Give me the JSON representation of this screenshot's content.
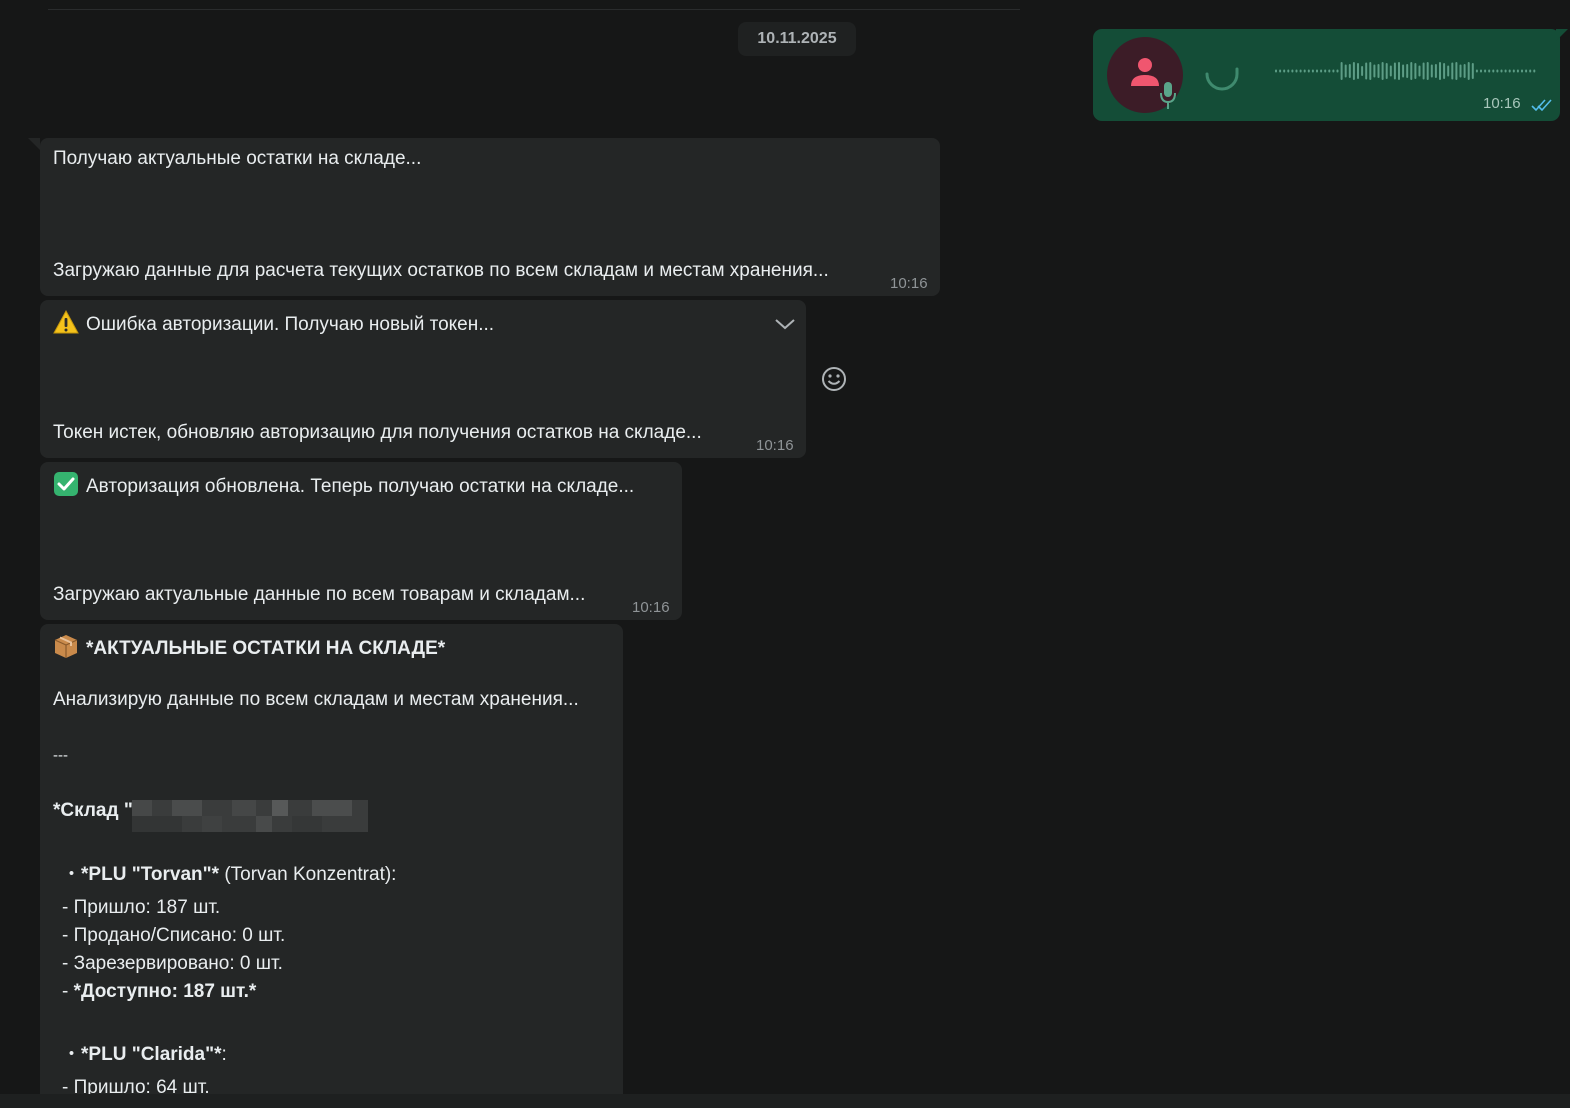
{
  "date_separator": "10.11.2025",
  "voice_message": {
    "time": "10:16",
    "status_icon": "double-check-icon",
    "accent_color": "#53bdeb"
  },
  "messages": [
    {
      "lines": [
        "Получаю актуальные остатки на складе...",
        "Загружаю данные для расчета текущих остатков по всем складам и местам хранения..."
      ],
      "time": "10:16"
    },
    {
      "icon": "warning-icon",
      "lines": [
        "Ошибка авторизации. Получаю новый токен...",
        "Токен истек, обновляю авторизацию для получения остатков на складе..."
      ],
      "time": "10:16"
    },
    {
      "icon": "check-mark-icon",
      "lines": [
        "Авторизация обновлена. Теперь получаю остатки на складе...",
        "Загружаю актуальные данные по всем товарам и складам..."
      ],
      "time": "10:16"
    }
  ],
  "stock_report": {
    "icon": "package-icon",
    "title": "*АКТУАЛЬНЫЕ ОСТАТКИ НА СКЛАДЕ*",
    "intro": "Анализирую данные по всем складам и местам хранения...",
    "separator": "---",
    "warehouse_prefix": "*Склад \"",
    "items": [
      {
        "bullet": "・",
        "name": "*PLU \"Torvan\"*",
        "suffix": " (Torvan Konzentrat):",
        "lines": [
          "- Пришло: 187 шт.",
          "- Продано/Списано: 0 шт.",
          "- Зарезервировано: 0 шт."
        ],
        "available_prefix": "- ",
        "available": "*Доступно: 187 шт.*"
      },
      {
        "bullet": "・",
        "name": "*PLU \"Clarida\"*",
        "suffix": ":",
        "lines": [
          "- Пришло: 64 шт."
        ]
      }
    ]
  }
}
